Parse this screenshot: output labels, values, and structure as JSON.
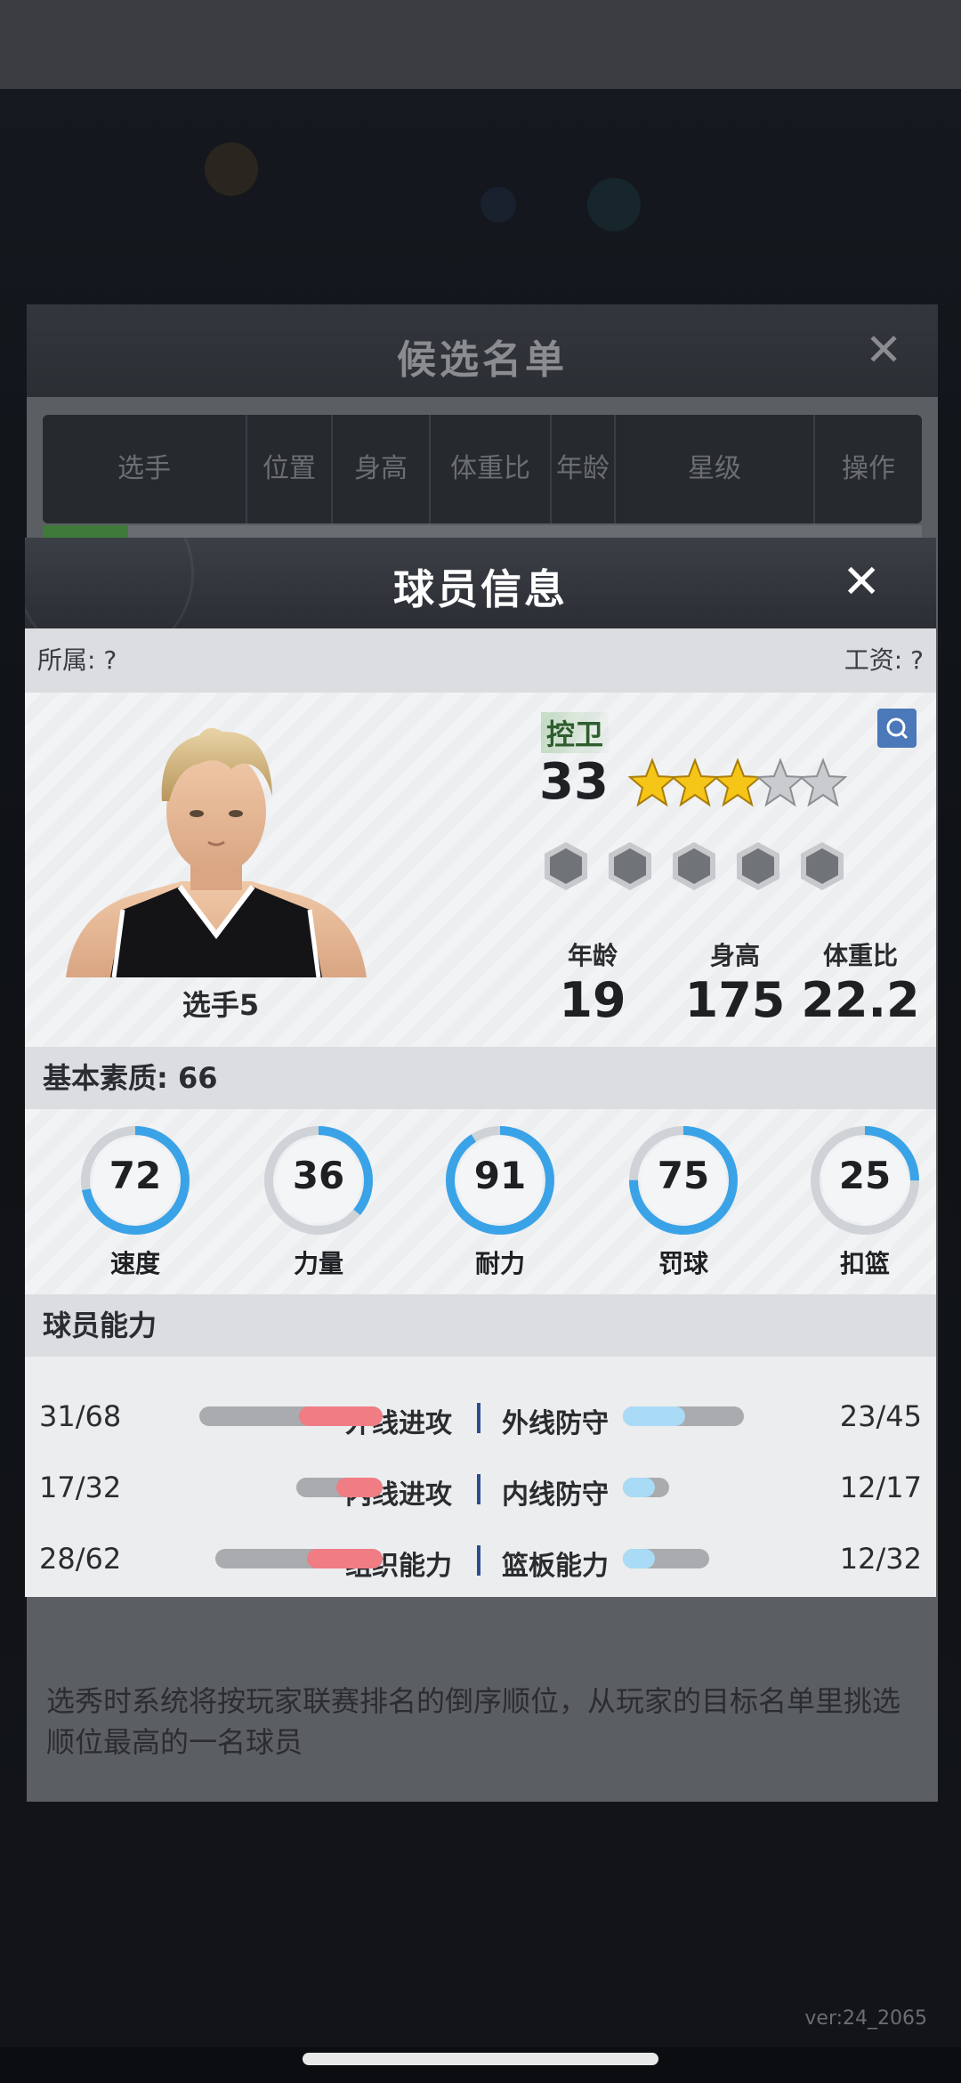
{
  "version": "ver:24_2065",
  "candidate_list": {
    "title": "候选名单",
    "close_glyph": "✕",
    "columns": [
      "选手",
      "位置",
      "身高",
      "体重比",
      "年龄",
      "星级",
      "操作"
    ],
    "note": "选秀时系统将按玩家联赛排名的倒序顺位，从玩家的目标名单里挑选顺位最高的一名球员"
  },
  "player_modal": {
    "title": "球员信息",
    "close_glyph": "✕",
    "affiliation": "所属: ?",
    "salary": "工资: ?",
    "player_name": "选手5",
    "position": "控卫",
    "rating": "33",
    "stars_filled": 3,
    "stars_total": 5,
    "badge_count": 5,
    "stats": [
      {
        "label": "年龄",
        "value": "19"
      },
      {
        "label": "身高",
        "value": "175"
      },
      {
        "label": "体重比",
        "value": "22.2"
      }
    ],
    "basic_quality_label": "基本素质: 66",
    "attributes": [
      {
        "label": "速度",
        "value": "72",
        "fill": 0.72
      },
      {
        "label": "力量",
        "value": "36",
        "fill": 0.36
      },
      {
        "label": "耐力",
        "value": "91",
        "fill": 0.91
      },
      {
        "label": "罚球",
        "value": "75",
        "fill": 0.75
      },
      {
        "label": "扣篮",
        "value": "25",
        "fill": 0.25
      }
    ],
    "abilities_label": "球员能力",
    "abilities": [
      {
        "left_label": "外线进攻",
        "left_value": "31/68",
        "right_label": "外线防守",
        "right_value": "23/45"
      },
      {
        "left_label": "内线进攻",
        "left_value": "17/32",
        "right_label": "内线防守",
        "right_value": "12/17"
      },
      {
        "left_label": "组织能力",
        "left_value": "28/62",
        "right_label": "篮板能力",
        "right_value": "12/32"
      }
    ]
  },
  "colors": {
    "ring_blue": "#3aa3e8",
    "ring_track": "#cfd2d6",
    "attack_red": "#f07c84",
    "defense_blue": "#a9dbf6",
    "star_gold": "#f5c518"
  }
}
